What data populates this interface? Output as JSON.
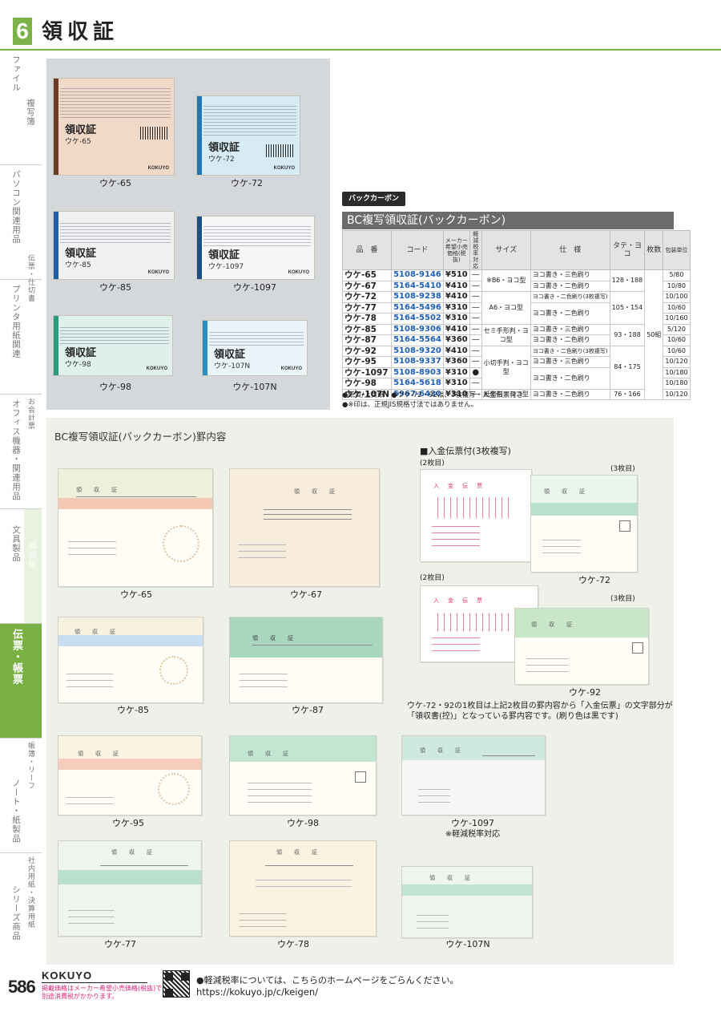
{
  "header": {
    "chapter": "6",
    "title": "領収証"
  },
  "side_index": [
    {
      "label": "ファイル"
    },
    {
      "label": "複写簿"
    },
    {
      "label": "パソコン関連用品"
    },
    {
      "label": "伝票・仕切書"
    },
    {
      "label": "プリンタ用紙関連"
    },
    {
      "label": "オフィス機器・関連用品"
    },
    {
      "label": "お会計票"
    },
    {
      "label": "文具製品"
    },
    {
      "label": "領収証"
    },
    {
      "label": "伝票・帳票"
    },
    {
      "label": "帳簿・リーフ"
    },
    {
      "label": "ノート・紙製品"
    },
    {
      "label": "社内用紙・決算用紙"
    },
    {
      "label": "シリーズ商品"
    }
  ],
  "products": [
    {
      "model": "ウケ-65",
      "slip_title": "領収証",
      "slip_model": "ウケ-65",
      "accent": "#6b3b25",
      "tint": "#f1d9c8"
    },
    {
      "model": "ウケ-72",
      "slip_title": "領収証",
      "slip_model": "ウケ-72",
      "accent": "#1f78b4",
      "tint": "#d7ebf5"
    },
    {
      "model": "ウケ-85",
      "slip_title": "領収証",
      "slip_model": "ウケ-85",
      "accent": "#1f5fa3",
      "tint": "#eef1f0"
    },
    {
      "model": "ウケ-1097",
      "slip_title": "領収証",
      "slip_model": "ウケ-1097",
      "accent": "#1d4f86",
      "tint": "#f6f6f6"
    },
    {
      "model": "ウケ-98",
      "slip_title": "領収証",
      "slip_model": "ウケ-98",
      "accent": "#2a9b7e",
      "tint": "#dff0ea"
    },
    {
      "model": "ウケ-107N",
      "slip_title": "領収証",
      "slip_model": "ウケ-107N",
      "accent": "#2a8ec0",
      "tint": "#eaf4f8"
    }
  ],
  "brand": "KOKUYO",
  "tag": "バックカーボン",
  "table": {
    "title": "BC複写領収証(バックカーボン)",
    "headers": [
      "品　番",
      "コード",
      "メーカー希望小売価格(税抜)",
      "軽減税率対応",
      "サイズ",
      "仕　様",
      "タテ・ヨコ",
      "枚数",
      "包装単位"
    ],
    "rows": [
      {
        "pn": "ウケ-65",
        "code": "5108-9146",
        "price": "¥510",
        "tax": "—",
        "size": "※B6・ヨコ型",
        "spec": "ヨコ書き・三色刷り",
        "dims": "128・188",
        "sheets": "50組",
        "pack": "5/80"
      },
      {
        "pn": "ウケ-67",
        "code": "5164-5410",
        "price": "¥410",
        "tax": "—",
        "size": "",
        "spec": "ヨコ書き・二色刷り",
        "dims": "",
        "sheets": "",
        "pack": "10/80"
      },
      {
        "pn": "ウケ-72",
        "code": "5108-9238",
        "price": "¥410",
        "tax": "—",
        "size": "A6・ヨコ型",
        "spec": "ヨコ書き・二色刷り(3枚複写)",
        "dims": "105・154",
        "sheets": "",
        "pack": "10/100"
      },
      {
        "pn": "ウケ-77",
        "code": "5164-5496",
        "price": "¥310",
        "tax": "—",
        "size": "",
        "spec": "ヨコ書き・二色刷り",
        "dims": "",
        "sheets": "",
        "pack": "10/60"
      },
      {
        "pn": "ウケ-78",
        "code": "5164-5502",
        "price": "¥310",
        "tax": "—",
        "size": "",
        "spec": "",
        "dims": "",
        "sheets": "",
        "pack": "10/160"
      },
      {
        "pn": "ウケ-85",
        "code": "5108-9306",
        "price": "¥410",
        "tax": "—",
        "size": "セミ手形判・ヨコ型",
        "spec": "ヨコ書き・三色刷り",
        "dims": "93・188",
        "sheets": "",
        "pack": "5/120"
      },
      {
        "pn": "ウケ-87",
        "code": "5164-5564",
        "price": "¥360",
        "tax": "—",
        "size": "",
        "spec": "ヨコ書き・二色刷り",
        "dims": "",
        "sheets": "",
        "pack": "10/60"
      },
      {
        "pn": "ウケ-92",
        "code": "5108-9320",
        "price": "¥410",
        "tax": "—",
        "size": "小切手判・ヨコ型",
        "spec": "ヨコ書き・二色刷り(3枚複写)",
        "dims": "84・175",
        "sheets": "",
        "pack": "10/60"
      },
      {
        "pn": "ウケ-95",
        "code": "5108-9337",
        "price": "¥360",
        "tax": "—",
        "size": "",
        "spec": "ヨコ書き・三色刷り",
        "dims": "",
        "sheets": "",
        "pack": "10/120"
      },
      {
        "pn": "ウケ-1097",
        "code": "5108-8903",
        "price": "¥310",
        "tax": "●",
        "size": "",
        "spec": "ヨコ書き・二色刷り",
        "dims": "",
        "sheets": "",
        "pack": "10/180"
      },
      {
        "pn": "ウケ-98",
        "code": "5164-5618",
        "price": "¥310",
        "tax": "—",
        "size": "",
        "spec": "",
        "dims": "",
        "sheets": "",
        "pack": "10/180"
      },
      {
        "pn": "ウケ-107N",
        "code": "5967-6430",
        "price": "¥310",
        "tax": "—",
        "size": "紙幣判・ヨコ型",
        "spec": "ヨコ書き・二色刷り",
        "dims": "76・166",
        "sheets": "",
        "pack": "10/120"
      }
    ],
    "notes": [
      "●紙質/上質紙　●ウケ-72・92は、3枚複写・入金伝票付き",
      "●※印は、正規JIS規格寸法ではありません。"
    ]
  },
  "layouts": {
    "heading": "BC複写領収証(バックカーボン)罫内容",
    "forms": [
      {
        "model": "ウケ-65",
        "form_title": "領　収　証",
        "band": "#f3c9b3",
        "pattern": "#f6ecd5"
      },
      {
        "model": "ウケ-67",
        "form_title": "領　収　証",
        "band": "",
        "pattern": "#f8ecdc"
      },
      {
        "model": "ウケ-85",
        "form_title": "領　収　証",
        "band": "#c9def0",
        "pattern": "#f7f2e0"
      },
      {
        "model": "ウケ-87",
        "form_title": "領　収　証",
        "band": "#a9d6bf",
        "pattern": "#eef3e8"
      },
      {
        "model": "ウケ-95",
        "form_title": "領　収　証",
        "band": "#f6cdbc",
        "pattern": "#f9f3e1"
      },
      {
        "model": "ウケ-98",
        "form_title": "領　収　証",
        "band": "#c3e6d3",
        "pattern": "#f1f6ec"
      },
      {
        "model": "ウケ-1097",
        "form_title": "領　収　証",
        "band": "#cfe9e2",
        "pattern": "#f4f7f4"
      },
      {
        "model": "ウケ-77",
        "form_title": "領　収　証",
        "band": "#b9e0cc",
        "pattern": "#eff4ec"
      },
      {
        "model": "ウケ-78",
        "form_title": "領　収　証",
        "band": "",
        "pattern": "#fbf2e2"
      },
      {
        "model": "ウケ-107N",
        "form_title": "領　収　証",
        "band": "#bfe4d2",
        "pattern": "#eef5ef"
      }
    ],
    "triple": {
      "heading": "■入金伝票付(3枚複写)",
      "label_2": "(2枚目)",
      "label_3": "(3枚目)",
      "slip_title": "入　金　伝　票",
      "caption_72": "ウケ-72",
      "caption_92": "ウケ-92"
    },
    "explain": [
      "ウケ-72・92の1枚目は上記2枚目の罫内容から「入金伝票」の文字部分が",
      "「領収書(控)」となっている罫内容です。(刷り色は黒です)"
    ],
    "tax_note": "※軽減税率対応"
  },
  "footer": {
    "page_number": "586",
    "price_note": [
      "掲載価格はメーカー希望小売価格(税抜)です。",
      "別途消費税がかかります。"
    ],
    "tax_note": "●軽減税率については、こちらのホームページをごらんください。",
    "url": "https://kokuyo.jp/c/keigen/"
  }
}
